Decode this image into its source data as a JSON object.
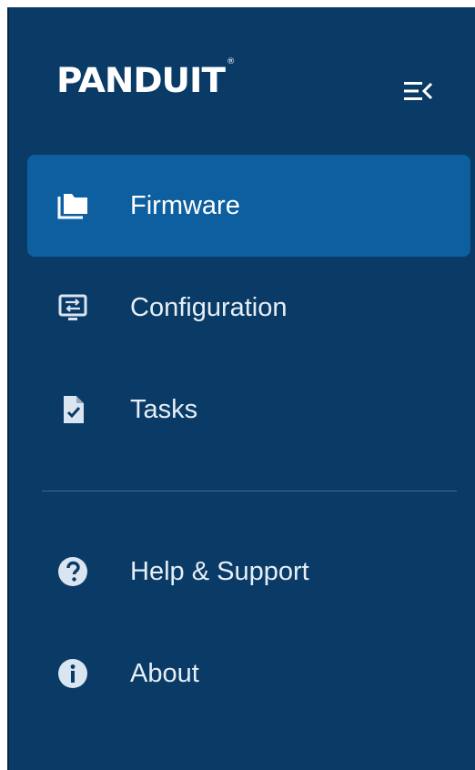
{
  "brand": {
    "logo_text": "PANDUIT",
    "registered_mark": "®"
  },
  "header": {
    "collapse_icon": "menu-collapse-icon"
  },
  "nav": {
    "primary": [
      {
        "label": "Firmware",
        "icon": "folder-icon",
        "active": true
      },
      {
        "label": "Configuration",
        "icon": "monitor-swap-icon",
        "active": false
      },
      {
        "label": "Tasks",
        "icon": "file-check-icon",
        "active": false
      }
    ],
    "secondary": [
      {
        "label": "Help & Support",
        "icon": "help-circle-icon",
        "active": false
      },
      {
        "label": "About",
        "icon": "info-circle-icon",
        "active": false
      }
    ]
  },
  "colors": {
    "sidebar_bg": "#0a3a66",
    "active_bg": "#0d5fa0",
    "text": "#ffffff",
    "icon": "#d9e5f0"
  }
}
